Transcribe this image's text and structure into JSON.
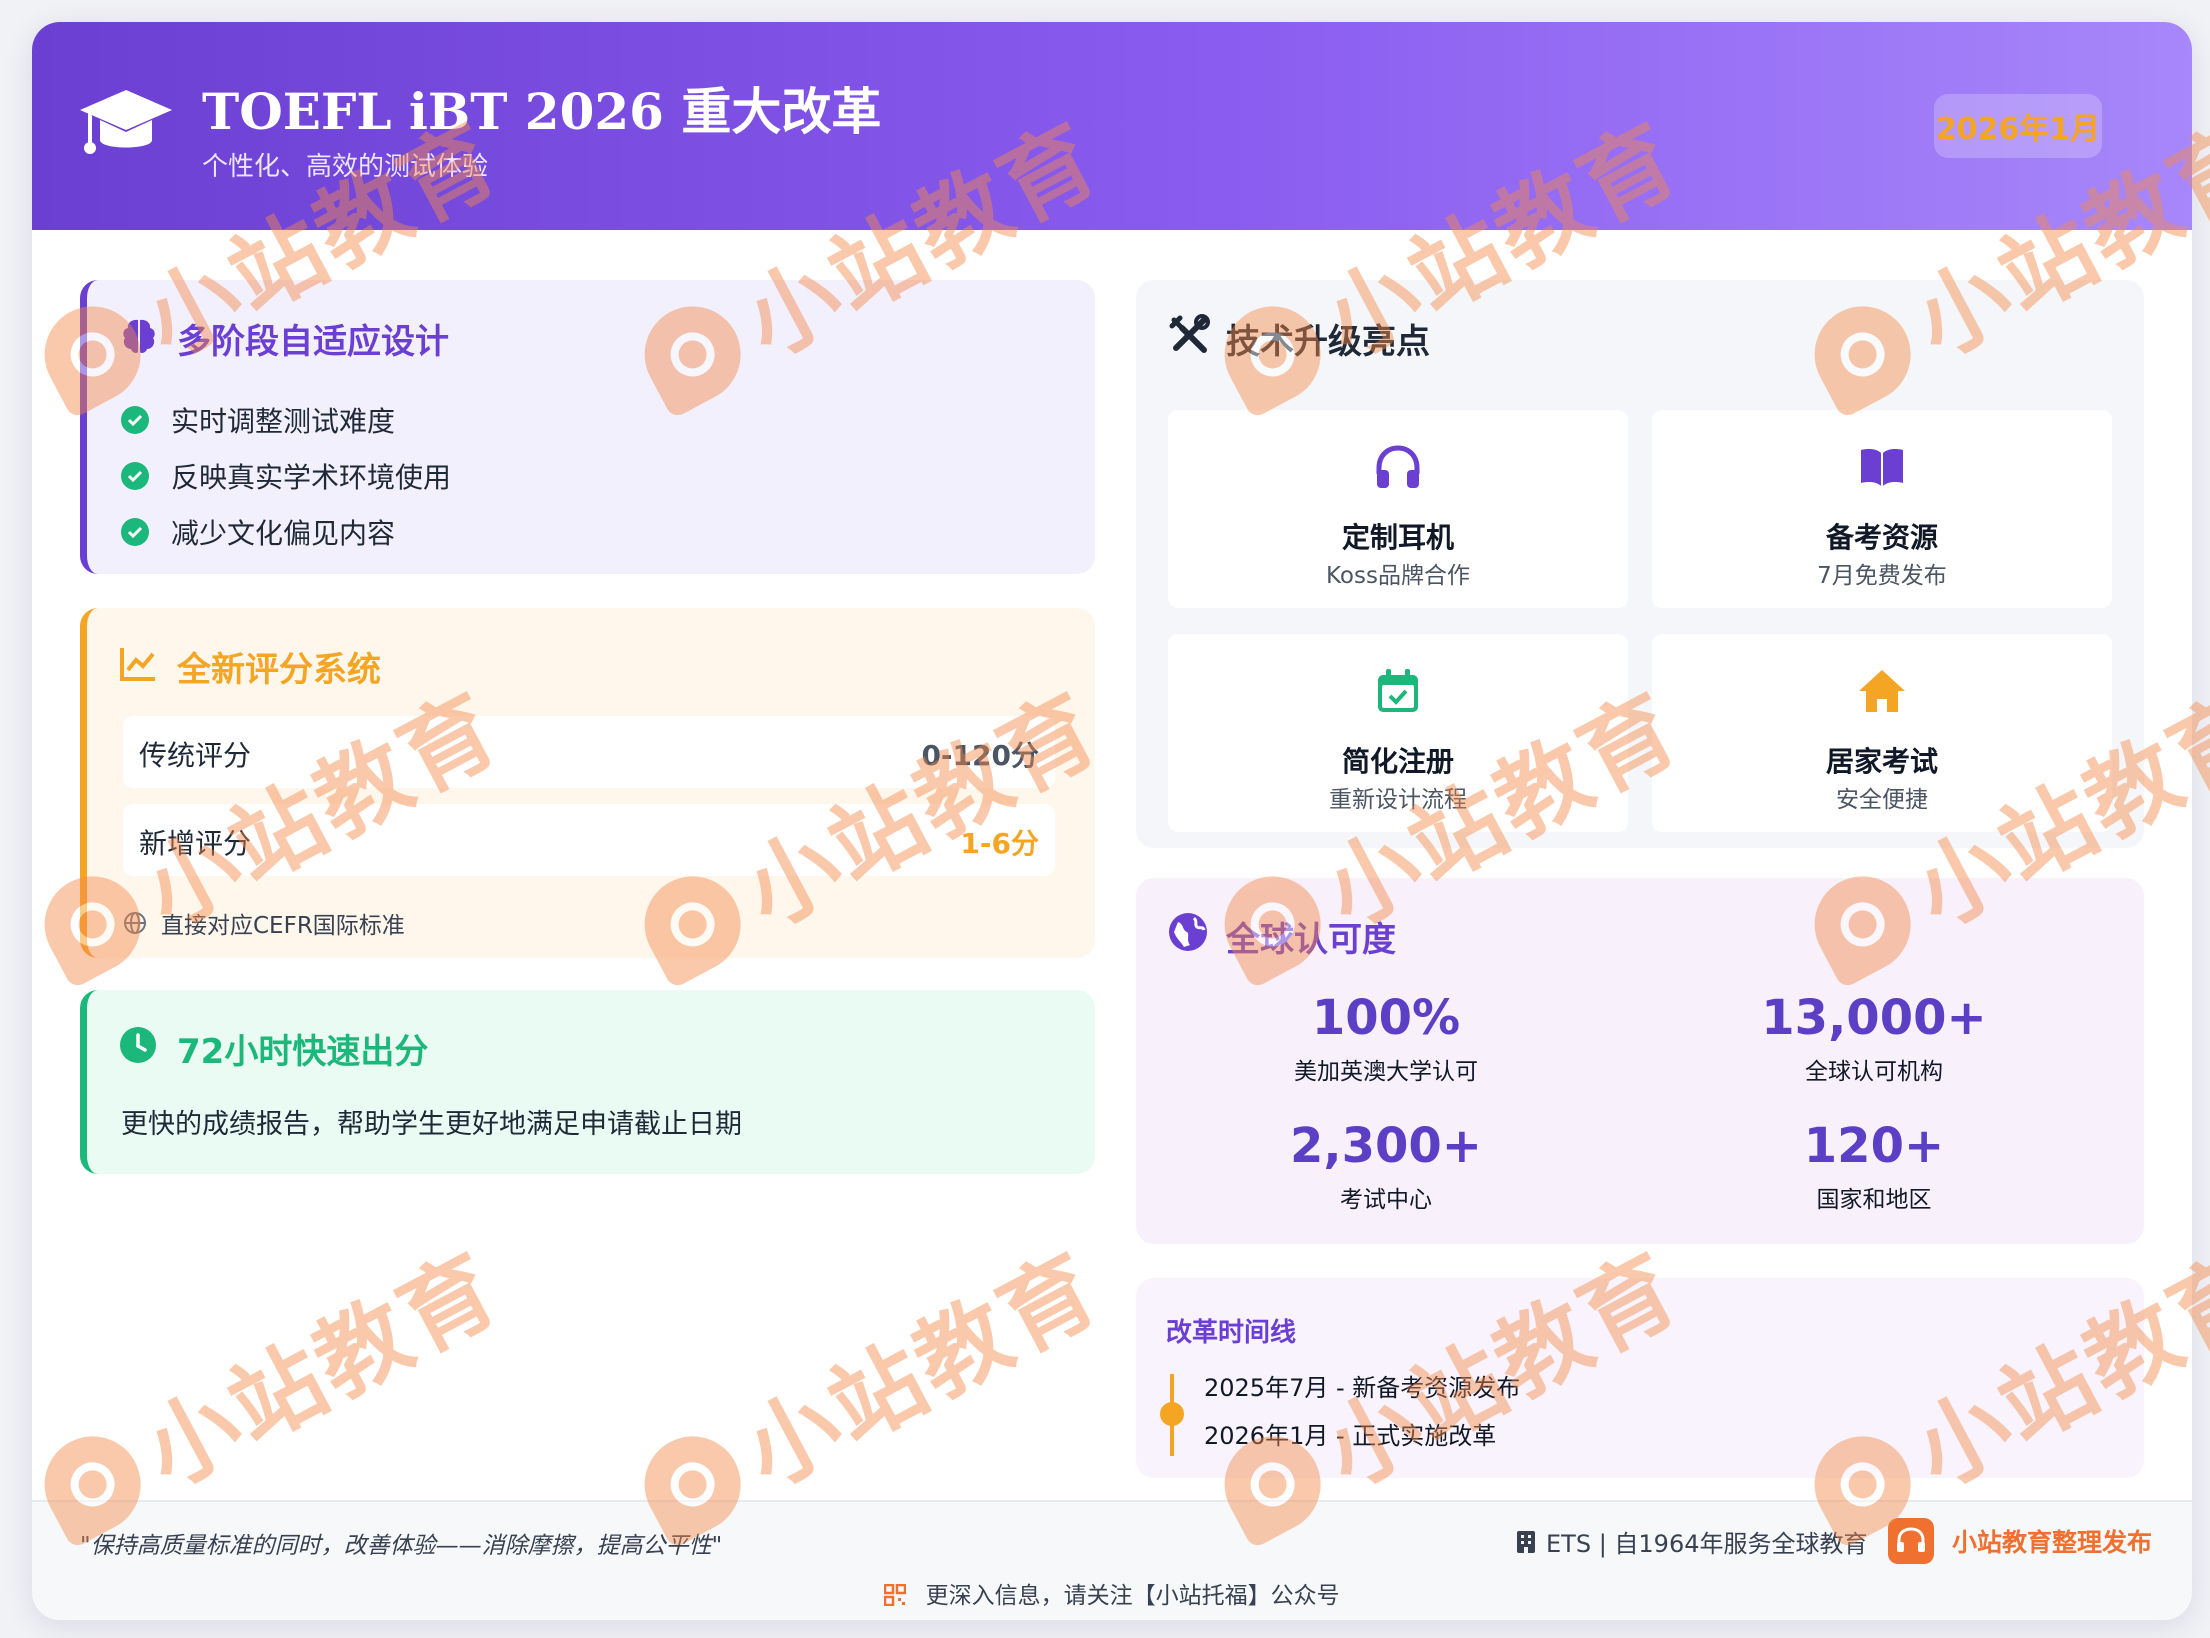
{
  "header": {
    "title": "TOEFL iBT 2026 重大改革",
    "subtitle": "个性化、高效的测试体验",
    "date_badge": "2026年1月"
  },
  "adaptive": {
    "title": "多阶段自适应设计",
    "icon": "brain-icon",
    "items": [
      "实时调整测试难度",
      "反映真实学术环境使用",
      "减少文化偏见内容"
    ]
  },
  "scoring": {
    "title": "全新评分系统",
    "icon": "chart-line-icon",
    "rows": [
      {
        "label": "传统评分",
        "value": "0-120分"
      },
      {
        "label": "新增评分",
        "value": "1-6分"
      }
    ],
    "note": "直接对应CEFR国际标准"
  },
  "fast": {
    "title": "72小时快速出分",
    "icon": "clock-icon",
    "text": "更快的成绩报告，帮助学生更好地满足申请截止日期"
  },
  "tech": {
    "title": "技术升级亮点",
    "icon": "tools-icon",
    "tiles": [
      {
        "name": "定制耳机",
        "sub": "Koss品牌合作",
        "icon": "headphones-icon"
      },
      {
        "name": "备考资源",
        "sub": "7月免费发布",
        "icon": "book-icon"
      },
      {
        "name": "简化注册",
        "sub": "重新设计流程",
        "icon": "calendar-check-icon"
      },
      {
        "name": "居家考试",
        "sub": "安全便捷",
        "icon": "home-icon"
      }
    ]
  },
  "global": {
    "title": "全球认可度",
    "icon": "globe-icon",
    "stats": [
      {
        "number": "100%",
        "label": "美加英澳大学认可"
      },
      {
        "number": "13,000+",
        "label": "全球认可机构"
      },
      {
        "number": "2,300+",
        "label": "考试中心"
      },
      {
        "number": "120+",
        "label": "国家和地区"
      }
    ]
  },
  "timeline": {
    "title": "改革时间线",
    "items": [
      "2025年7月 - 新备考资源发布",
      "2026年1月 - 正式实施改革"
    ]
  },
  "footer": {
    "quote": "\"保持高质量标准的同时，改善体验——消除摩擦，提高公平性\"",
    "ets": "ETS | 自1964年服务全球教育",
    "publisher": "小站教育整理发布",
    "follow": "更深入信息，请关注【小站托福】公众号"
  },
  "watermark": "小站教育",
  "colors": {
    "primary": "#6a3fd1",
    "orange": "#f5a524",
    "green": "#1cb77a",
    "brand": "#f07030"
  }
}
